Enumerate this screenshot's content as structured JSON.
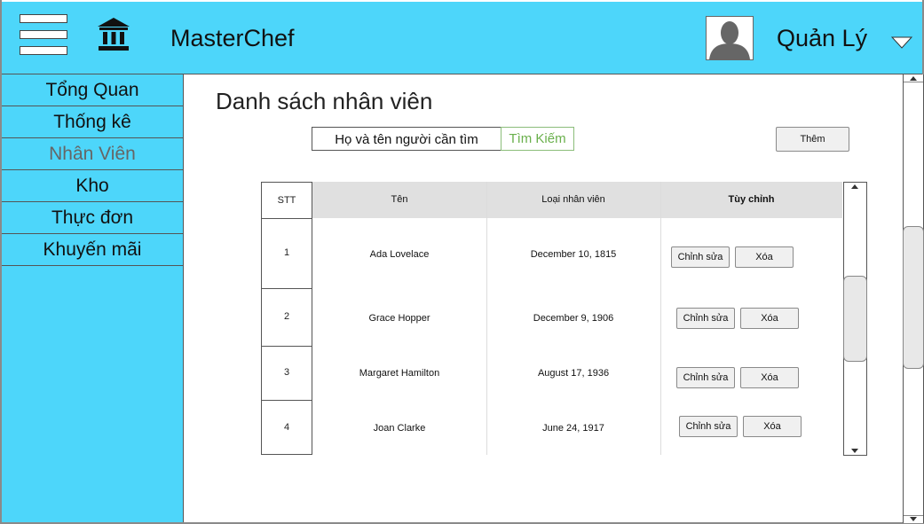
{
  "header": {
    "app_title": "MasterChef",
    "user_name": "Quản Lý",
    "background_color": "#4dd6fa"
  },
  "sidebar": {
    "items": [
      {
        "label": "Tổng Quan",
        "active": false
      },
      {
        "label": "Thống kê",
        "active": false
      },
      {
        "label": "Nhân Viên",
        "active": true
      },
      {
        "label": "Kho",
        "active": false
      },
      {
        "label": "Thực đơn",
        "active": false
      },
      {
        "label": "Khuyến mãi",
        "active": false
      }
    ]
  },
  "main": {
    "page_title": "Danh sách nhân viên",
    "search_value": "Họ và tên người cần tìm",
    "search_button": "Tìm Kiếm",
    "add_button": "Thêm"
  },
  "table": {
    "columns": [
      "STT",
      "Tên",
      "Loại nhân viên",
      "Tùy chỉnh"
    ],
    "rows": [
      {
        "stt": "1",
        "name": "Ada Lovelace",
        "type": "December 10, 1815"
      },
      {
        "stt": "2",
        "name": "Grace Hopper",
        "type": "December 9, 1906"
      },
      {
        "stt": "3",
        "name": "Margaret Hamilton",
        "type": "August 17, 1936"
      },
      {
        "stt": "4",
        "name": "Joan Clarke",
        "type": "June 24, 1917"
      }
    ],
    "edit_label": "Chỉnh sửa",
    "delete_label": "Xóa"
  },
  "icons": {
    "menu": "hamburger-menu-icon",
    "logo": "bank-icon",
    "avatar": "user-avatar-icon",
    "dropdown": "chevron-down-icon"
  }
}
